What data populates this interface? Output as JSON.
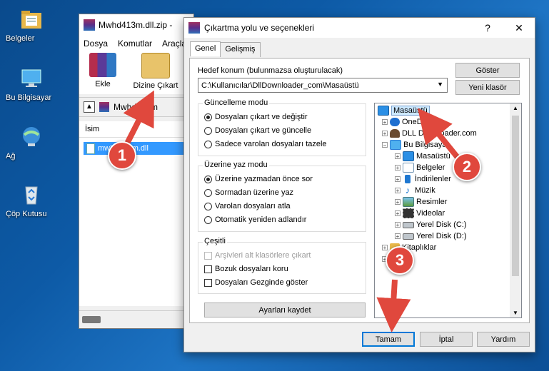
{
  "desktop": {
    "icons": [
      {
        "label": "Belgeler",
        "icon": "folder-documents-icon"
      },
      {
        "label": "Bu Bilgisayar",
        "icon": "computer-icon"
      },
      {
        "label": "Ağ",
        "icon": "network-icon"
      },
      {
        "label": "Çöp Kutusu",
        "icon": "recycle-bin-icon"
      }
    ]
  },
  "winrar": {
    "title": "Mwhd413m.dll.zip -",
    "menu": [
      "Dosya",
      "Komutlar",
      "Araçla"
    ],
    "tools": [
      "Ekle",
      "Dizine Çıkart"
    ],
    "address": "Mwhd413m",
    "column_header": "İsim",
    "file": "mwhd413m.dll"
  },
  "dialog": {
    "title": "Çıkartma yolu ve seçenekleri",
    "help": "?",
    "close": "✕",
    "tabs": [
      "Genel",
      "Gelişmiş"
    ],
    "dest_label": "Hedef konum (bulunmazsa oluşturulacak)",
    "dest_value": "C:\\Kullanıcılar\\DllDownloader_com\\Masaüstü",
    "show_button": "Göster",
    "new_folder_button": "Yeni klasör",
    "update_mode": {
      "title": "Güncelleme modu",
      "options": [
        "Dosyaları çıkart ve değiştir",
        "Dosyaları çıkart ve güncelle",
        "Sadece varolan dosyaları tazele"
      ],
      "selected": 0
    },
    "overwrite_mode": {
      "title": "Üzerine yaz modu",
      "options": [
        "Üzerine yazmadan önce sor",
        "Sormadan üzerine yaz",
        "Varolan dosyaları atla",
        "Otomatik yeniden adlandır"
      ],
      "selected": 0
    },
    "misc": {
      "title": "Çeşitli",
      "options": [
        "Arşivleri alt klasörlere çıkart",
        "Bozuk dosyaları koru",
        "Dosyaları Gezginde göster"
      ]
    },
    "save_settings": "Ayarları kaydet",
    "tree": [
      {
        "label": "Masaüstü",
        "selected": true,
        "icon": "desktop-icon"
      },
      {
        "label": "OneDrive",
        "icon": "cloud-icon"
      },
      {
        "label": "DLL Downloader.com",
        "icon": "user-icon"
      },
      {
        "label": "Bu Bilgisayar",
        "icon": "computer-icon"
      },
      {
        "label": "Masaüstü",
        "icon": "desktop-icon"
      },
      {
        "label": "Belgeler",
        "icon": "documents-icon"
      },
      {
        "label": "İndirilenler",
        "icon": "download-icon"
      },
      {
        "label": "Müzik",
        "icon": "music-icon"
      },
      {
        "label": "Resimler",
        "icon": "pictures-icon"
      },
      {
        "label": "Videolar",
        "icon": "videos-icon"
      },
      {
        "label": "Yerel Disk (C:)",
        "icon": "drive-icon"
      },
      {
        "label": "Yerel Disk (D:)",
        "icon": "drive-icon"
      },
      {
        "label": "Kitaplıklar",
        "icon": "folder-icon"
      },
      {
        "label": "Ağ",
        "icon": "network-icon"
      }
    ],
    "ok": "Tamam",
    "cancel": "İptal",
    "help_button": "Yardım"
  },
  "annotations": [
    "1",
    "2",
    "3"
  ],
  "colors": {
    "annotation": "#e0483d",
    "selection": "#3399ff"
  }
}
